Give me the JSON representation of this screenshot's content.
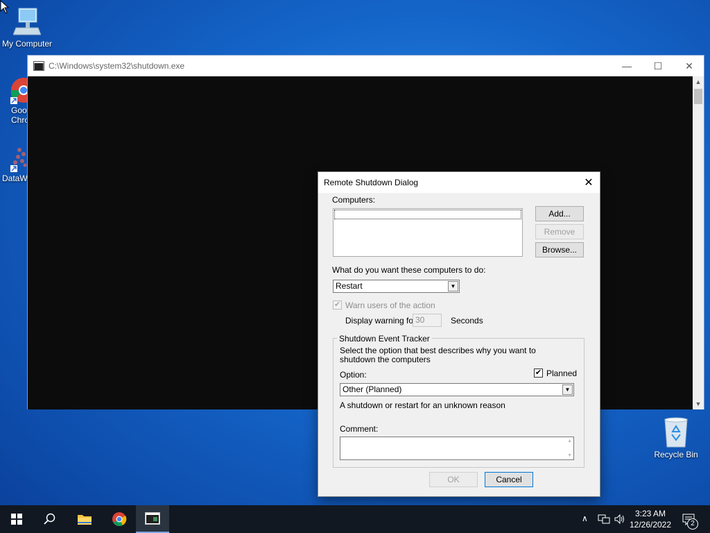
{
  "desktop": {
    "icons": [
      {
        "label": "My Computer"
      },
      {
        "label": "Goo\nChro"
      },
      {
        "label": "DataW"
      },
      {
        "label": "Recycle Bin"
      }
    ]
  },
  "console": {
    "title": "C:\\Windows\\system32\\shutdown.exe",
    "minimize": "—",
    "maximize": "☐",
    "close": "✕"
  },
  "dialog": {
    "title": "Remote Shutdown Dialog",
    "close": "✕",
    "computers_label": "Computers:",
    "add_label": "Add...",
    "remove_label": "Remove",
    "browse_label": "Browse...",
    "action_label": "What do you want these computers to do:",
    "action_value": "Restart",
    "warn_label": "Warn users of the action",
    "warn_checked": "✔",
    "display_warning_label": "Display warning for",
    "warning_seconds": "30",
    "seconds_label": "Seconds",
    "tracker": {
      "group_label": "Shutdown Event Tracker",
      "description": "Select the option that best describes why you want to shutdown the computers",
      "option_label": "Option:",
      "planned_label": "Planned",
      "planned_checked": "✔",
      "option_value": "Other (Planned)",
      "reason_text": "A shutdown or restart for an unknown reason",
      "comment_label": "Comment:"
    },
    "ok_label": "OK",
    "cancel_label": "Cancel"
  },
  "taskbar": {
    "time": "3:23 AM",
    "date": "12/26/2022",
    "notification_count": "2"
  }
}
